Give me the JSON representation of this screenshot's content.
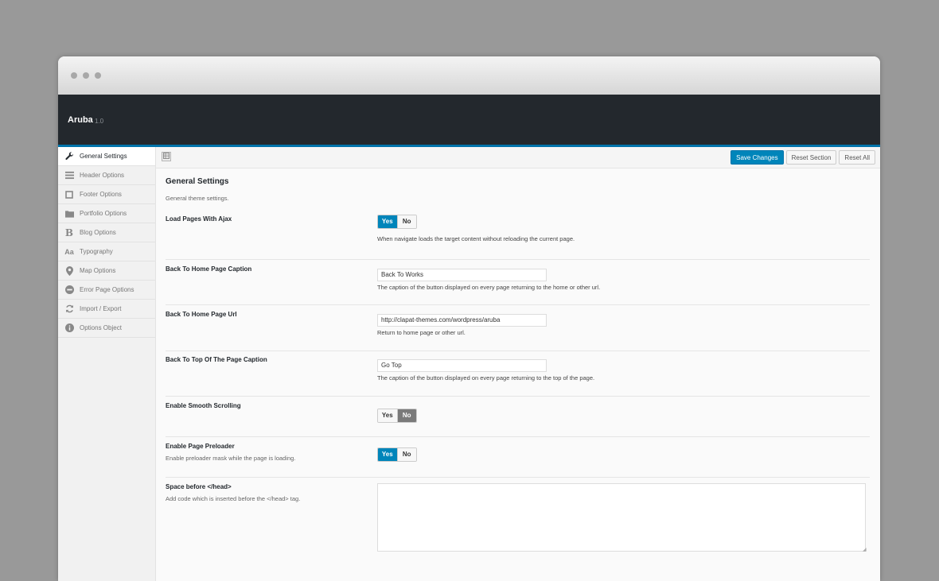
{
  "app": {
    "name": "Aruba",
    "version": "1.0"
  },
  "sidebar": {
    "items": [
      {
        "label": "General Settings",
        "icon": "wrench-icon",
        "active": true
      },
      {
        "label": "Header Options",
        "icon": "menu-lines-icon"
      },
      {
        "label": "Footer Options",
        "icon": "square-icon"
      },
      {
        "label": "Portfolio Options",
        "icon": "folder-icon"
      },
      {
        "label": "Blog Options",
        "icon": "b-letter-icon"
      },
      {
        "label": "Typography",
        "icon": "typography-icon"
      },
      {
        "label": "Map Options",
        "icon": "map-pin-icon"
      },
      {
        "label": "Error Page Options",
        "icon": "minus-circle-icon"
      },
      {
        "label": "Import / Export",
        "icon": "refresh-icon"
      },
      {
        "label": "Options Object",
        "icon": "info-icon"
      }
    ]
  },
  "toolbar": {
    "save_label": "Save Changes",
    "reset_section_label": "Reset Section",
    "reset_all_label": "Reset All"
  },
  "section": {
    "title": "General Settings",
    "description": "General theme settings."
  },
  "fields": {
    "ajax": {
      "label": "Load Pages With Ajax",
      "yes": "Yes",
      "no": "No",
      "value": "Yes",
      "help": "When navigate loads the target content without reloading the current page."
    },
    "home_caption": {
      "label": "Back To Home Page Caption",
      "value": "Back To Works",
      "help": "The caption of the button displayed on every page returning to the home or other url."
    },
    "home_url": {
      "label": "Back To Home Page Url",
      "value": "http://clapat-themes.com/wordpress/aruba",
      "help": "Return to home page or other url."
    },
    "top_caption": {
      "label": "Back To Top Of The Page Caption",
      "value": "Go Top",
      "help": "The caption of the button displayed on every page returning to the top of the page."
    },
    "smooth_scroll": {
      "label": "Enable Smooth Scrolling",
      "yes": "Yes",
      "no": "No",
      "value": "No"
    },
    "preloader": {
      "label": "Enable Page Preloader",
      "sub": "Enable preloader mask while the page is loading.",
      "yes": "Yes",
      "no": "No",
      "value": "Yes"
    },
    "space_head": {
      "label": "Space before </head>",
      "sub": "Add code which is inserted before the </head> tag.",
      "value": ""
    }
  },
  "colors": {
    "accent": "#0085ba",
    "header_bg": "#23282d",
    "header_border": "#0073aa"
  }
}
